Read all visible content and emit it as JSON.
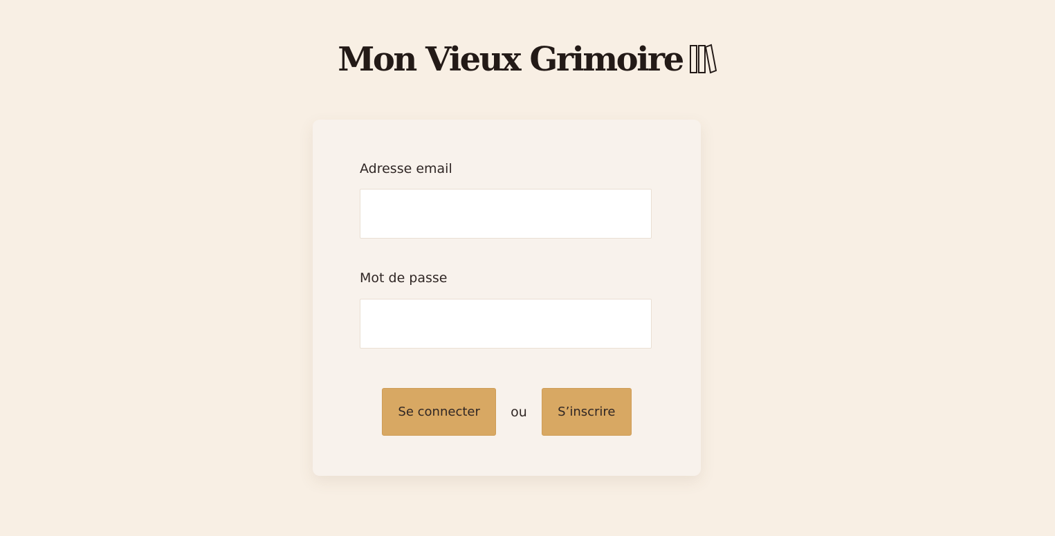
{
  "app": {
    "title": "Mon Vieux Grimoire",
    "logo_icon": "books-icon"
  },
  "login_form": {
    "email": {
      "label": "Adresse email",
      "value": "",
      "placeholder": ""
    },
    "password": {
      "label": "Mot de passe",
      "value": "",
      "placeholder": ""
    },
    "login_button_label": "Se connecter",
    "separator_text": "ou",
    "signup_button_label": "S’inscrire"
  },
  "colors": {
    "background": "#f8efe4",
    "card": "#f8f2ec",
    "button": "#d8a863",
    "text": "#2b2220"
  }
}
